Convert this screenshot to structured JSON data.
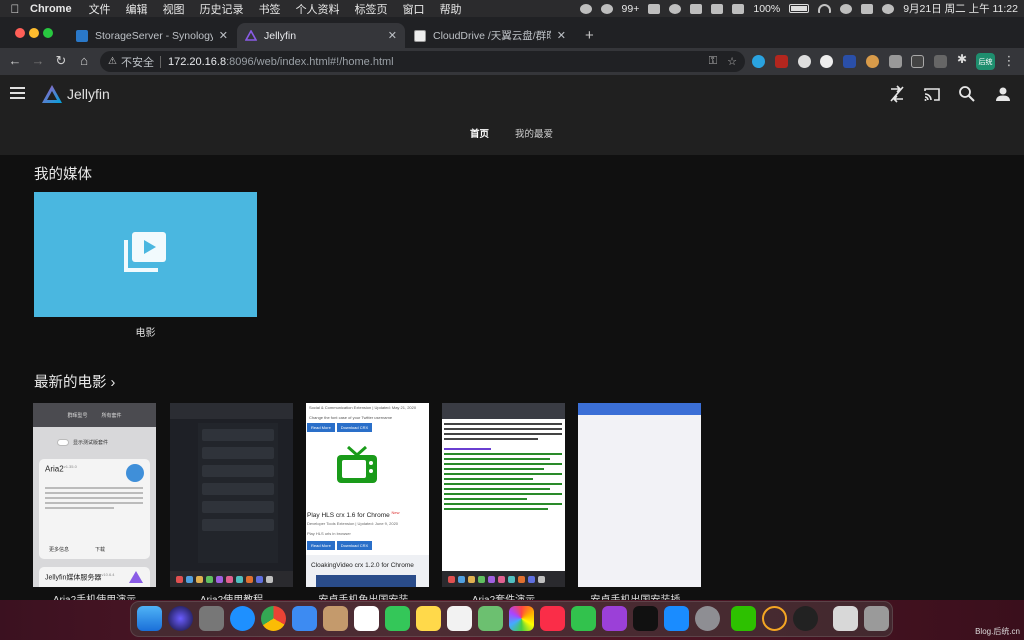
{
  "menubar": {
    "app": "Chrome",
    "items": [
      "文件",
      "编辑",
      "视图",
      "历史记录",
      "书签",
      "个人资料",
      "标签页",
      "窗口",
      "帮助"
    ],
    "status": {
      "notifications": "99+",
      "battery": "100%",
      "datetime": "9月21日 周二 上午 11:22"
    }
  },
  "tabs": [
    {
      "title": "StorageServer - Synology DiskS",
      "favicon_color": "#2a78c8"
    },
    {
      "title": "Jellyfin",
      "favicon_color": "#7b4fd1",
      "active": true
    },
    {
      "title": "CloudDrive /天翼云盘/群晖套件",
      "favicon_color": "#8a8a8a"
    }
  ],
  "omnibox": {
    "security_label": "不安全",
    "host": "172.20.16.8",
    "path": ":8096/web/index.html#!/home.html"
  },
  "profile": {
    "label": "后统"
  },
  "jellyfin": {
    "brand": "Jellyfin",
    "tabs": {
      "home": "首页",
      "favorites": "我的最爱"
    },
    "my_media_title": "我的媒体",
    "library": {
      "label": "电影",
      "color": "#4ab7e0"
    },
    "latest_title": "最新的电影",
    "latest_chevron": "›",
    "latest_movies": [
      {
        "title": "Aria2手机使用演示"
      },
      {
        "title": "Aria2使用教程"
      },
      {
        "title": "安卓手机免出国安装..."
      },
      {
        "title": "Aria2套件演示"
      },
      {
        "title": "安卓手机出国安装插..."
      }
    ],
    "thumbs": {
      "m1": {
        "tabs": [
          "群晖型号",
          "所有套件"
        ],
        "toggle": "显示测试版套件",
        "card_title": "Aria2",
        "card_version": "v1.35.0",
        "more": "更多信息",
        "download": "下载",
        "card2_title": "Jellyfin媒体服务器",
        "card2_version": "v10.6.4"
      },
      "m3": {
        "header": "Social & Communication Extension | Updated: May 21, 2020",
        "line": "Change the font case of your Twitter username",
        "btn1": "Read More",
        "btn2": "Download CRX",
        "title1": "Play HLS crx 1.6 for Chrome",
        "new": "New",
        "meta1": "Developer Tools Extension | Updated: June 9, 2020",
        "line2": "Play HLS urls in browser",
        "title2": "CloakingVideo crx 1.2.0 for Chrome"
      }
    }
  },
  "watermark": "Blog.后统.cn"
}
